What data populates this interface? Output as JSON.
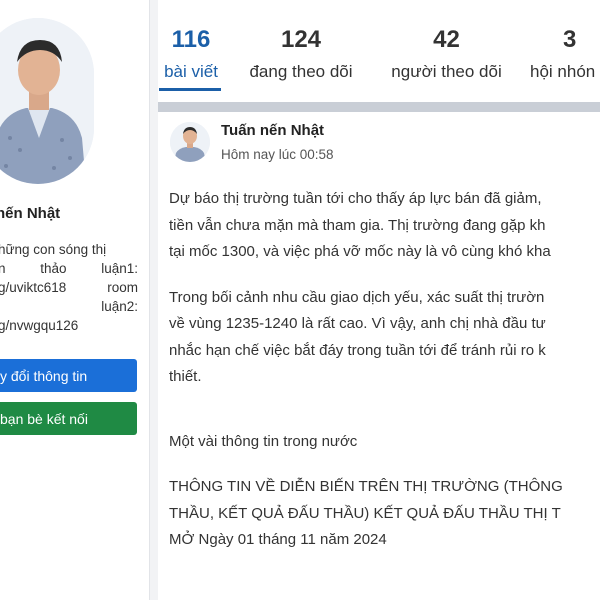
{
  "profile": {
    "name_fragment": "nến Nhật",
    "bio_lines": [
      "hững con sóng thị",
      [
        "n",
        "thảo",
        "luận1:"
      ],
      [
        "g/uviktc618",
        "room"
      ],
      "luận2:",
      "g/nvwgqu126"
    ],
    "buttons": {
      "edit_profile": "y đổi thông tin",
      "friends": "bạn bè kết nối"
    }
  },
  "stats": [
    {
      "value": "116",
      "label": "bài viết",
      "active": true
    },
    {
      "value": "124",
      "label": "đang theo dõi"
    },
    {
      "value": "42",
      "label": "người theo dõi"
    },
    {
      "value": "3",
      "label": "hội nhón"
    }
  ],
  "post": {
    "author": "Tuấn nến Nhật",
    "time": "Hôm nay lúc 00:58",
    "paragraph1": [
      "Dự báo thị trường tuần tới cho thấy áp lực bán đã giảm,",
      "tiền vẫn chưa mặn mà tham gia. Thị trường đang gặp kh",
      "tại mốc 1300, và việc phá vỡ mốc này là vô cùng khó kha"
    ],
    "paragraph2": [
      "Trong bối cảnh nhu cầu giao dịch yếu, xác suất thị trườn",
      "về vùng 1235-1240 là rất cao. Vì vậy, anh chị nhà đầu tư",
      "nhắc hạn chế việc bắt đáy trong tuần tới để tránh rủi ro k",
      "thiết."
    ],
    "paragraph3": "Một vài thông tin trong nước",
    "paragraph4": [
      "THÔNG TIN VỀ DIỄN BIẾN TRÊN THỊ TRƯỜNG (THÔNG",
      "THẦU, KẾT QUẢ ĐẤU THẦU) KẾT QUẢ ĐẤU THẦU THỊ T",
      "MỞ Ngày 01 tháng 11 năm 2024"
    ]
  }
}
